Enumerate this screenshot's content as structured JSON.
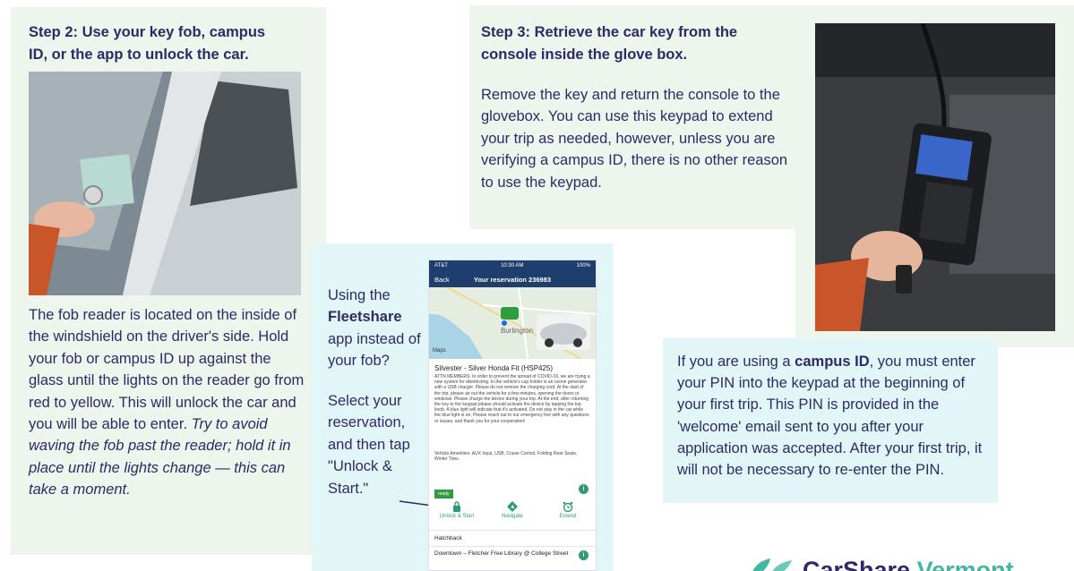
{
  "step2": {
    "heading": [
      "Step 2: Use your key fob, campus",
      "ID, or the app to unlock the car."
    ],
    "body": {
      "plain": "The fob reader is located on the inside of the windshield on the driver's side. Hold your fob or campus ID up against the glass until the lights on the reader go from red to yellow. This will unlock the car and you will be able to enter.",
      "italic": "Try to avoid waving the fob past the reader; hold it in place until the lights change — this can take a moment."
    }
  },
  "step3": {
    "heading": [
      "Step 3: Retrieve the car key from the",
      "console inside the glove box."
    ],
    "body": "Remove the key and return the console to the glovebox. You can use this keypad to extend your trip as needed, however, unless you are verifying a campus ID, there is no other reason to use the keypad."
  },
  "app_section": {
    "line1_a": "Using the",
    "app_name": "Fleetshare",
    "line1_b": "app instead of your fob?",
    "line2": "Select your reservation, and then tap \"Unlock & Start.\""
  },
  "campus": {
    "pre": "If you are using a",
    "bold": "campus ID",
    "post": ", you must enter your PIN into the keypad at the beginning of your first trip. This PIN is provided in the 'welcome' email sent to you after your application was accepted. After your first trip, it will not be necessary to re-enter the PIN."
  },
  "phone": {
    "status_left": "AT&T",
    "status_time": "10:30 AM",
    "status_right": "100%",
    "back": "Back",
    "title": "Your reservation 236983",
    "map_city": "Burlington",
    "map_badge": "Maps",
    "vehicle": "Silvester - Silver Honda Fit (HSP425)",
    "description": "ATTN MEMBERS: In order to prevent the spread of COVID-19, we are trying a new system for disinfecting. In the vehicle's cup holder is an ozone generator with a USB charger. Please do not remove the charging cord. At the start of the trip, please air out the vehicle for a few minutes, opening the doors or windows. Please charge the device during your trip. At the end, after returning the key to the keypad please should activate the device by tapping the top knob. A blue light will indicate that it's activated. Do not stay in the car while the blue light is on. Please reach out to our emergency line with any questions or issues, and thank you for your cooperation!",
    "amenities": "Vehicle Amenities: AUX Input, USB, Cruise Control, Folding Rear Seats, Winter Tires.",
    "ready": "ready",
    "actions": [
      {
        "label": "Unlock & Start"
      },
      {
        "label": "Navigate"
      },
      {
        "label": "Extend"
      }
    ],
    "car_type": "Hatchback",
    "location": "Downtown – Fletcher Free Library @ College Street"
  },
  "logo": {
    "word1": "CarShare",
    "word2": "Vermont"
  },
  "colors": {
    "navy": "#2e2a66",
    "green_panel": "#eef5ec",
    "cyan_panel": "#e2f6f8",
    "teal": "#45b5a4"
  }
}
